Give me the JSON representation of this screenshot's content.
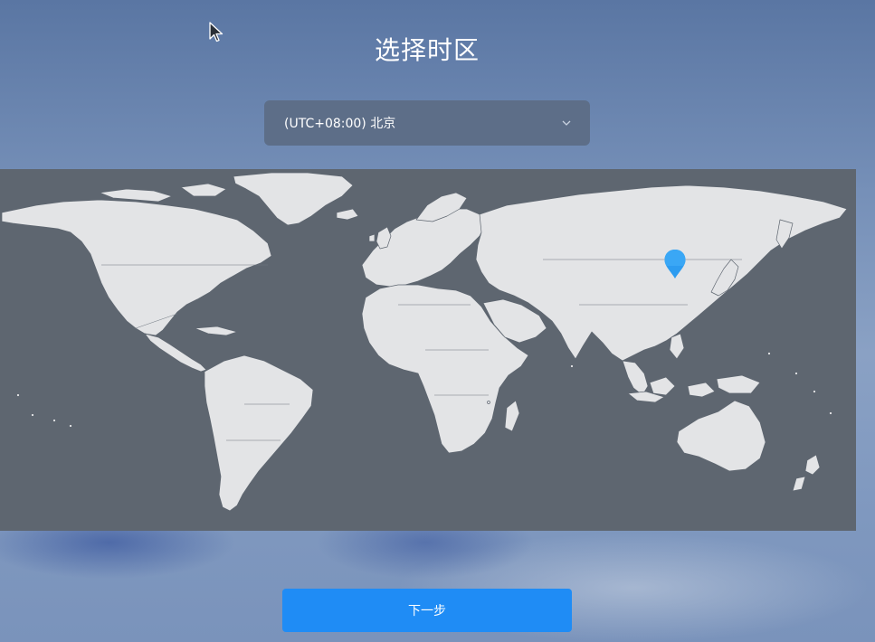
{
  "page": {
    "title": "选择时区"
  },
  "timezone_select": {
    "value": "(UTC+08:00) 北京"
  },
  "map": {
    "selected_city": "北京"
  },
  "footer": {
    "next_label": "下一步"
  },
  "colors": {
    "accent": "#1f8cf5",
    "map_background": "#5e6670",
    "land": "#e3e4e6",
    "pin": "#2d9cf0",
    "select_background": "#5d6e88"
  }
}
